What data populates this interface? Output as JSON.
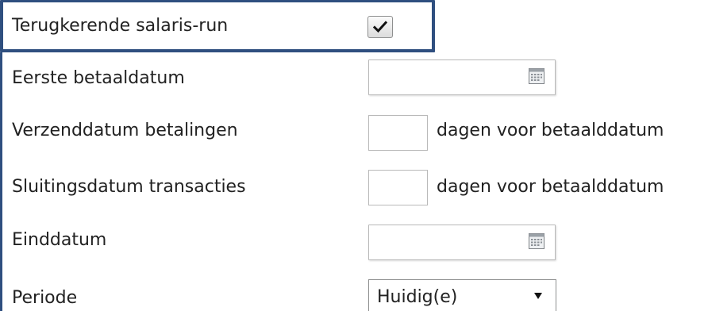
{
  "form": {
    "recurring": {
      "label": "Terugkerende salaris-run",
      "checked": true,
      "icon": "checkmark-icon"
    },
    "first_payment_date": {
      "label": "Eerste betaaldatum",
      "value": "",
      "icon": "calendar-icon"
    },
    "send_date": {
      "label": "Verzenddatum betalingen",
      "value": "",
      "suffix": "dagen voor betaalddatum"
    },
    "closing_date": {
      "label": "Sluitingsdatum transacties",
      "value": "",
      "suffix": "dagen voor betaalddatum"
    },
    "end_date": {
      "label": "Einddatum",
      "value": "",
      "icon": "calendar-icon"
    },
    "period": {
      "label": "Periode",
      "selected": "Huidig(e)",
      "icon": "chevron-down-icon"
    }
  },
  "colors": {
    "highlight_border": "#2f4f7f",
    "text": "#222222",
    "field_border": "#b9b9b9"
  }
}
